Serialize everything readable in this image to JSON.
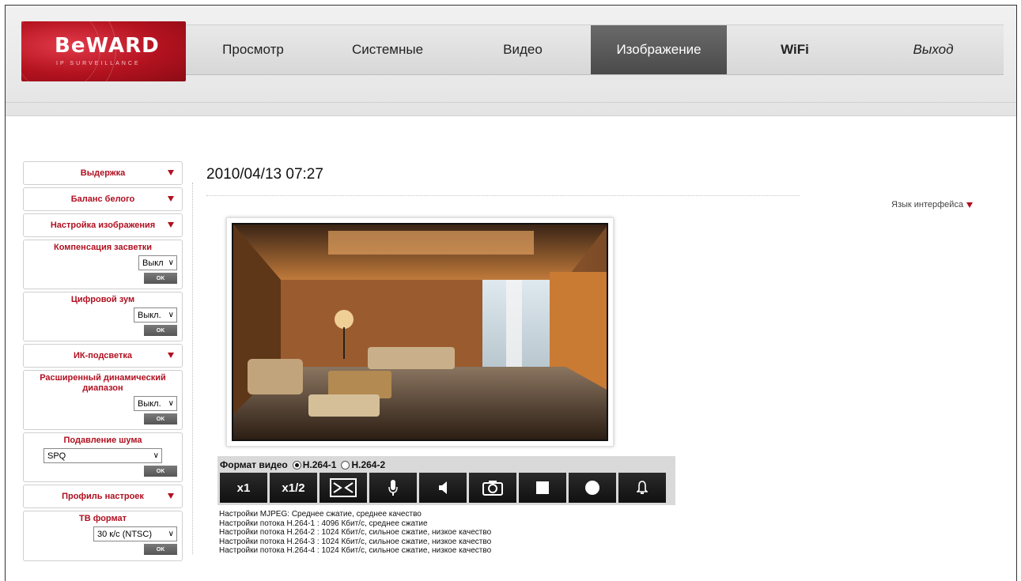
{
  "logo": {
    "brand": "BeWARD",
    "sub": "IP SURVEILLANCE"
  },
  "nav": [
    {
      "label": "Просмотр",
      "active": false
    },
    {
      "label": "Системные",
      "active": false
    },
    {
      "label": "Видео",
      "active": false
    },
    {
      "label": "Изображение",
      "active": true
    },
    {
      "label": "WiFi",
      "active": false
    },
    {
      "label": "Выход",
      "active": false
    }
  ],
  "sidebar": {
    "exposure": "Выдержка",
    "white_balance": "Баланс белого",
    "image_settings": "Настройка изображения",
    "backlight": {
      "title": "Компенсация засветки",
      "value": "Выкл",
      "ok": "OK"
    },
    "digital_zoom": {
      "title": "Цифровой зум",
      "value": "Выкл.",
      "ok": "OK"
    },
    "ir": "ИК-подсветка",
    "wdr": {
      "title": "Расширенный динамический диапазон",
      "value": "Выкл.",
      "ok": "OK"
    },
    "noise": {
      "title": "Подавление шума",
      "value": "SPQ",
      "ok": "OK"
    },
    "profile": "Профиль настроек",
    "tv": {
      "title": "ТВ формат",
      "value": "30 к/с (NTSC)",
      "ok": "OK"
    }
  },
  "main": {
    "datetime": "2010/04/13 07:27",
    "language": "Язык интерфейса",
    "format_label": "Формат видео",
    "format_options": [
      "H.264-1",
      "H.264-2"
    ],
    "selected_format": "H.264-1",
    "buttons": [
      {
        "label": "x1",
        "icon": ""
      },
      {
        "label": "x1/2",
        "icon": ""
      },
      {
        "label": "",
        "icon": "fullscreen-icon"
      },
      {
        "label": "",
        "icon": "microphone-icon"
      },
      {
        "label": "",
        "icon": "speaker-icon"
      },
      {
        "label": "",
        "icon": "camera-icon"
      },
      {
        "label": "",
        "icon": "stop-icon"
      },
      {
        "label": "",
        "icon": "record-icon"
      },
      {
        "label": "",
        "icon": "bell-icon"
      }
    ],
    "info_lines": [
      "Настройки MJPEG: Среднее сжатие, среднее качество",
      "Настройки потока H.264-1 : 4096 Кбит/с, среднее сжатие",
      "Настройки потока H.264-2 : 1024 Кбит/с, сильное сжатие, низкое качество",
      "Настройки потока H.264-3 : 1024 Кбит/с, сильное сжатие, низкое качество",
      "Настройки потока H.264-4 : 1024 Кбит/с, сильное сжатие, низкое качество"
    ]
  },
  "colors": {
    "accent": "#b01020",
    "active_tab": "#555555",
    "button": "#1a1a1a"
  }
}
